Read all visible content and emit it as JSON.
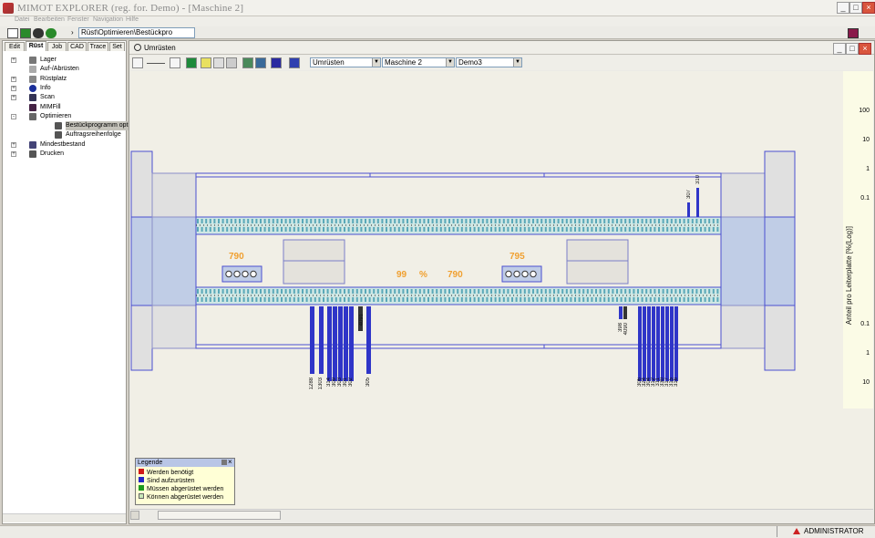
{
  "app": {
    "title": "MIMOT EXPLORER (reg. for. Demo) - [Maschine 2]",
    "user": "ADMINISTRATOR"
  },
  "menu": [
    "Datei",
    "Bearbeiten",
    "Fenster",
    "Navigation",
    "Hilfe"
  ],
  "toolbar": {
    "path": "Rüst\\Optimieren\\Bestückpro"
  },
  "tabs": [
    "Edit",
    "Rüst",
    "Job",
    "CAD",
    "Trace",
    "Set"
  ],
  "active_tab": "Rüst",
  "tree": [
    {
      "label": "Lager",
      "toggle": "+",
      "icon": "lager"
    },
    {
      "label": "Auf-/Abrüsten",
      "toggle": "",
      "icon": "auf"
    },
    {
      "label": "Rüstplatz",
      "toggle": "+",
      "icon": "ruest"
    },
    {
      "label": "Info",
      "toggle": "+",
      "icon": "info"
    },
    {
      "label": "Scan",
      "toggle": "+",
      "icon": "scan"
    },
    {
      "label": "MIMFill",
      "toggle": "",
      "icon": "fill"
    },
    {
      "label": "Optimieren",
      "toggle": "-",
      "icon": "opt"
    },
    {
      "label": "Bestückprogramm optimie",
      "toggle": "",
      "icon": "bp",
      "child": true,
      "selected": true
    },
    {
      "label": "Auftragsreihenfolge",
      "toggle": "",
      "icon": "ar",
      "child": true
    },
    {
      "label": "Mindestbestand",
      "toggle": "+",
      "icon": "min"
    },
    {
      "label": "Drucken",
      "toggle": "+",
      "icon": "print"
    }
  ],
  "child": {
    "title": "Umrüsten",
    "dropdowns": [
      "Umrüsten",
      "Maschine 2",
      "Demo3"
    ]
  },
  "machine": {
    "left_count": "790",
    "right_count": "795",
    "percent": "99",
    "percent_sign": "%",
    "total": "790",
    "top_right_labels": [
      "307",
      "310"
    ],
    "bottom_left_labels": [
      "1288",
      "1303",
      "314",
      "309",
      "303",
      "301",
      "302",
      "4091",
      "305"
    ],
    "bottom_right_labels": [
      "398",
      "4090",
      "306",
      "324",
      "304",
      "312",
      "311",
      "330",
      "317",
      "315",
      "316"
    ]
  },
  "scale": {
    "top_ticks": [
      "100",
      "10",
      "1",
      "0.1"
    ],
    "bottom_ticks": [
      "0.1",
      "1",
      "10"
    ],
    "label": "Anteil pro Leiterplatte [%(Log)]"
  },
  "legend": {
    "title": "Legende",
    "items": [
      {
        "label": "Werden benötigt",
        "color": "#d01818"
      },
      {
        "label": "Sind aufzurüsten",
        "color": "#2424c8"
      },
      {
        "label": "Müssen abgerüstet werden",
        "color": "#1c9a1c"
      },
      {
        "label": "Können abgerüstet werden",
        "color": "#c8e8b8"
      }
    ]
  },
  "colors": {
    "bar": "#2f35c8",
    "accent": "#f0a030",
    "frame": "#4a4fd0",
    "band": "#c0cde6"
  }
}
